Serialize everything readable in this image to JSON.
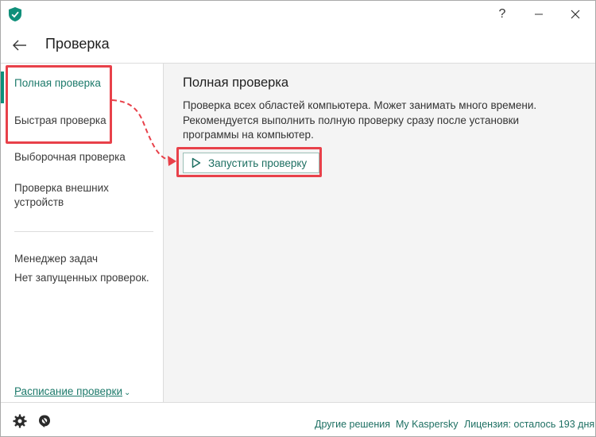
{
  "header": {
    "title": "Проверка"
  },
  "sidebar": {
    "items": [
      {
        "label": "Полная проверка"
      },
      {
        "label": "Быстрая проверка"
      },
      {
        "label": "Выборочная проверка"
      },
      {
        "label": "Проверка внешних устройств"
      }
    ],
    "task_manager_label": "Менеджер задач",
    "task_manager_status": "Нет запущенных проверок.",
    "schedule_link": "Расписание проверки"
  },
  "main": {
    "title": "Полная проверка",
    "description": "Проверка всех областей компьютера. Может занимать много времени. Рекомендуется выполнить полную проверку сразу после установки программы на компьютер.",
    "run_button": "Запустить проверку"
  },
  "footer": {
    "other_solutions": "Другие решения",
    "my_kaspersky": "My Kaspersky",
    "license": "Лицензия: осталось 193 дня"
  },
  "window_controls": {
    "help": "?",
    "minimize": "—",
    "close": "✕"
  },
  "colors": {
    "accent": "#1d7a6b",
    "highlight": "#e8414a",
    "brand": "#0f8f7a"
  }
}
